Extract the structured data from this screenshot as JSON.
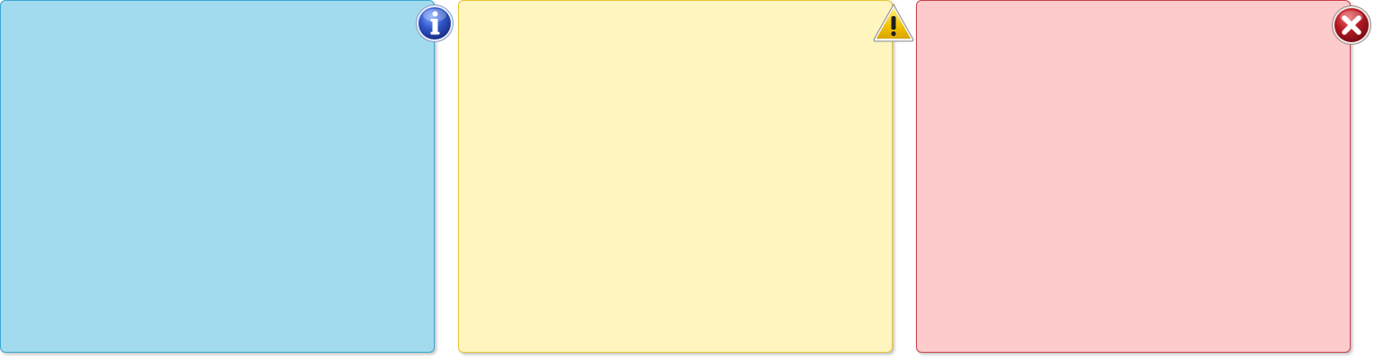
{
  "panels": [
    {
      "type": "info",
      "icon": "info-icon",
      "background": "#a2dbee",
      "border": "#3aa9d3"
    },
    {
      "type": "warning",
      "icon": "warning-icon",
      "background": "#fef5bf",
      "border": "#e9c634"
    },
    {
      "type": "error",
      "icon": "error-icon",
      "background": "#fdcbcc",
      "border": "#c9414a"
    }
  ],
  "colors": {
    "info_icon": "#2f55c8",
    "warning_icon": "#f2c300",
    "error_icon": "#b31822"
  }
}
